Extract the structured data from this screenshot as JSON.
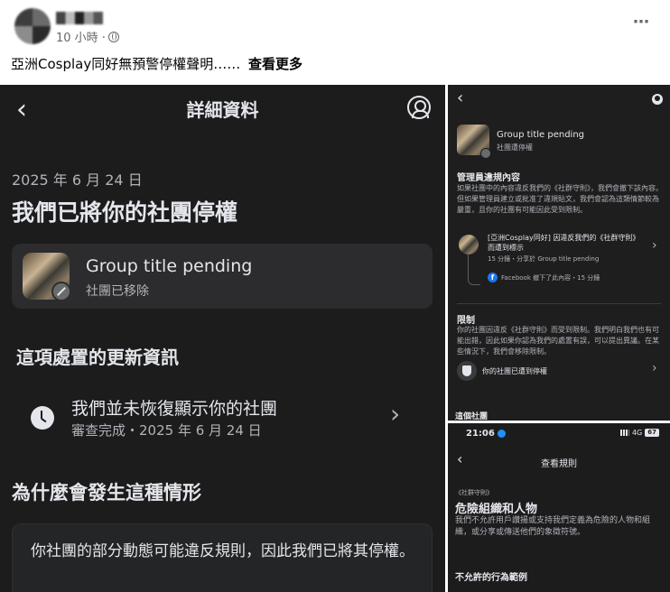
{
  "post": {
    "timestamp": "10 小時 ·",
    "text": "亞洲Cosplay同好無預警停權聲明……",
    "see_more": "查看更多",
    "more_icon": "⋯"
  },
  "main_panel": {
    "back": "‹",
    "title": "詳細資料",
    "date": "2025 年 6 月 24 日",
    "headline": "我們已將你的社團停權",
    "group_title": "Group title pending",
    "group_status": "社團已移除",
    "update_section": "這項處置的更新資訊",
    "update_title": "我們並未恢復顯示你的社團",
    "update_sub": "審查完成・2025 年 6 月 24 日",
    "update_chevron": "›",
    "why_section": "為什麼會發生這種情形",
    "why_text": "你社團的部分動態可能違反規則，因此我們已將其停權。"
  },
  "top_right_panel": {
    "back": "‹",
    "group_title": "Group title pending",
    "group_sub": "社團遭停權",
    "admin_heading": "管理員違規內容",
    "admin_text": "如果社團中的內容違反我們的《社群守則》，我們會撤下該內容。但如果管理員建立或批准了違規貼文，我們會認為這類情節較為嚴重，且你的社團有可能因此受到限制。",
    "post_title": "[亞洲Cosplay同好] 因違反我們的《社群守則》而遭到標示",
    "post_meta": "15 分鐘・分享於 Group title pending",
    "fb_text": "Facebook 撤下了此內容・15 分鐘",
    "restrict_heading": "限制",
    "restrict_text": "你的社團因違反《社群守則》而受到限制。我們明白我們也有可能出錯，因此如果你認為我們的處置有誤，可以提出異議。在某些情況下，我們會移除限制。",
    "restrict_label": "你的社團已遭到停權",
    "chevron": "›",
    "bottom_heading": "這個社團"
  },
  "bottom_right_panel": {
    "time": "21:06",
    "network": "4G",
    "battery": "67",
    "back": "‹",
    "title": "查看規則",
    "tag": "《社群守則》",
    "heading": "危險組織和人物",
    "text": "我們不允許用戶讚揚或支持我們定義為危險的人物和組織，或分享或傳送他們的象徵符號。",
    "heading2": "不允許的行為範例"
  },
  "colors": {
    "dark_bg": "#1c1c1d",
    "card_bg": "#2c2c2e",
    "text_primary": "#e4e6eb",
    "text_secondary": "#b0b3b8",
    "facebook_blue": "#1877f2"
  }
}
